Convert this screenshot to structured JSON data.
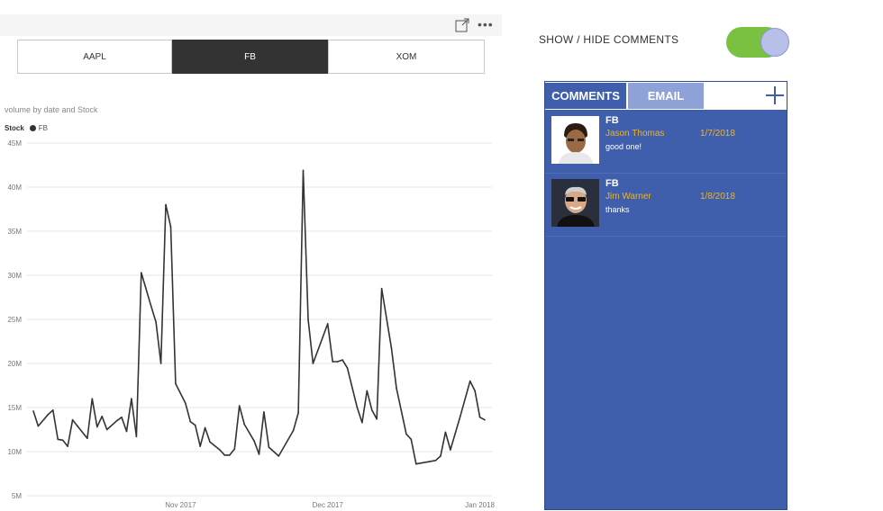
{
  "header": {
    "focus_icon": "focus-mode-icon",
    "more_icon": "more-options-icon",
    "more_glyph": "•••"
  },
  "slicer": {
    "options": [
      "AAPL",
      "FB",
      "XOM"
    ],
    "selected": "FB"
  },
  "toggle": {
    "label": "SHOW / HIDE COMMENTS",
    "state": "on",
    "on_color": "#7ac142"
  },
  "comments_panel": {
    "tabs": [
      {
        "label": "COMMENTS",
        "active": true
      },
      {
        "label": "EMAIL",
        "active": false
      }
    ],
    "add_icon": "plus-icon",
    "background_color": "#3f5fad",
    "items": [
      {
        "stock": "FB",
        "name": "Jason Thomas",
        "date": "1/7/2018",
        "text": "good one!",
        "avatar": "avatar-photo"
      },
      {
        "stock": "FB",
        "name": "Jim Warner",
        "date": "1/8/2018",
        "text": "thanks",
        "avatar": "avatar-photo"
      }
    ]
  },
  "chart_data": {
    "type": "line",
    "title": "volume by date and Stock",
    "legend_title": "Stock",
    "legend_position": "top-left",
    "grid": true,
    "series": [
      {
        "name": "FB",
        "color": "#333333",
        "values": [
          [
            "2017-10-02",
            14.6
          ],
          [
            "2017-10-03",
            12.9
          ],
          [
            "2017-10-05",
            14.2
          ],
          [
            "2017-10-06",
            14.7
          ],
          [
            "2017-10-07",
            11.4
          ],
          [
            "2017-10-08",
            11.3
          ],
          [
            "2017-10-09",
            10.6
          ],
          [
            "2017-10-10",
            13.6
          ],
          [
            "2017-10-11",
            12.9
          ],
          [
            "2017-10-13",
            11.5
          ],
          [
            "2017-10-14",
            16.0
          ],
          [
            "2017-10-15",
            12.8
          ],
          [
            "2017-10-16",
            14.0
          ],
          [
            "2017-10-17",
            12.5
          ],
          [
            "2017-10-19",
            13.5
          ],
          [
            "2017-10-20",
            13.9
          ],
          [
            "2017-10-21",
            12.3
          ],
          [
            "2017-10-22",
            16.0
          ],
          [
            "2017-10-23",
            11.7
          ],
          [
            "2017-10-24",
            30.3
          ],
          [
            "2017-10-26",
            26.5
          ],
          [
            "2017-10-27",
            24.7
          ],
          [
            "2017-10-28",
            20.0
          ],
          [
            "2017-10-29",
            38.0
          ],
          [
            "2017-10-30",
            35.5
          ],
          [
            "2017-10-31",
            17.7
          ],
          [
            "2017-11-02",
            15.5
          ],
          [
            "2017-11-03",
            13.4
          ],
          [
            "2017-11-04",
            13.0
          ],
          [
            "2017-11-05",
            10.6
          ],
          [
            "2017-11-06",
            12.7
          ],
          [
            "2017-11-07",
            11.1
          ],
          [
            "2017-11-09",
            10.2
          ],
          [
            "2017-11-10",
            9.6
          ],
          [
            "2017-11-11",
            9.6
          ],
          [
            "2017-11-12",
            10.3
          ],
          [
            "2017-11-13",
            15.2
          ],
          [
            "2017-11-14",
            13.1
          ],
          [
            "2017-11-16",
            11.2
          ],
          [
            "2017-11-17",
            9.7
          ],
          [
            "2017-11-18",
            14.5
          ],
          [
            "2017-11-19",
            10.5
          ],
          [
            "2017-11-21",
            9.5
          ],
          [
            "2017-11-24",
            12.4
          ],
          [
            "2017-11-25",
            14.4
          ],
          [
            "2017-11-26",
            41.9
          ],
          [
            "2017-11-27",
            25.0
          ],
          [
            "2017-11-28",
            20.0
          ],
          [
            "2017-11-30",
            23.0
          ],
          [
            "2017-12-01",
            24.5
          ],
          [
            "2017-12-02",
            20.2
          ],
          [
            "2017-12-03",
            20.2
          ],
          [
            "2017-12-04",
            20.4
          ],
          [
            "2017-12-05",
            19.5
          ],
          [
            "2017-12-07",
            15.0
          ],
          [
            "2017-12-08",
            13.3
          ],
          [
            "2017-12-09",
            16.9
          ],
          [
            "2017-12-10",
            14.7
          ],
          [
            "2017-12-11",
            13.7
          ],
          [
            "2017-12-12",
            28.5
          ],
          [
            "2017-12-14",
            21.7
          ],
          [
            "2017-12-15",
            17.2
          ],
          [
            "2017-12-17",
            12.0
          ],
          [
            "2017-12-18",
            11.4
          ],
          [
            "2017-12-19",
            8.6
          ],
          [
            "2017-12-22",
            8.9
          ],
          [
            "2017-12-23",
            9.0
          ],
          [
            "2017-12-24",
            9.5
          ],
          [
            "2017-12-25",
            12.2
          ],
          [
            "2017-12-26",
            10.2
          ],
          [
            "2017-12-28",
            14.0
          ],
          [
            "2017-12-30",
            18.0
          ],
          [
            "2017-12-31",
            16.9
          ],
          [
            "2018-01-01",
            13.9
          ],
          [
            "2018-01-02",
            13.6
          ]
        ]
      }
    ],
    "x_ticks": [
      {
        "date": "2017-11-01",
        "label": "Nov 2017"
      },
      {
        "date": "2017-12-01",
        "label": "Dec 2017"
      },
      {
        "date": "2018-01-01",
        "label": "Jan 2018"
      }
    ],
    "xlim": [
      "2017-10-02",
      "2018-01-02"
    ],
    "y_ticks": [
      {
        "value": 5,
        "label": "5M"
      },
      {
        "value": 10,
        "label": "10M"
      },
      {
        "value": 15,
        "label": "15M"
      },
      {
        "value": 20,
        "label": "20M"
      },
      {
        "value": 25,
        "label": "25M"
      },
      {
        "value": 30,
        "label": "30M"
      },
      {
        "value": 35,
        "label": "35M"
      },
      {
        "value": 40,
        "label": "40M"
      },
      {
        "value": 45,
        "label": "45M"
      }
    ],
    "ylim": [
      5,
      45
    ]
  }
}
